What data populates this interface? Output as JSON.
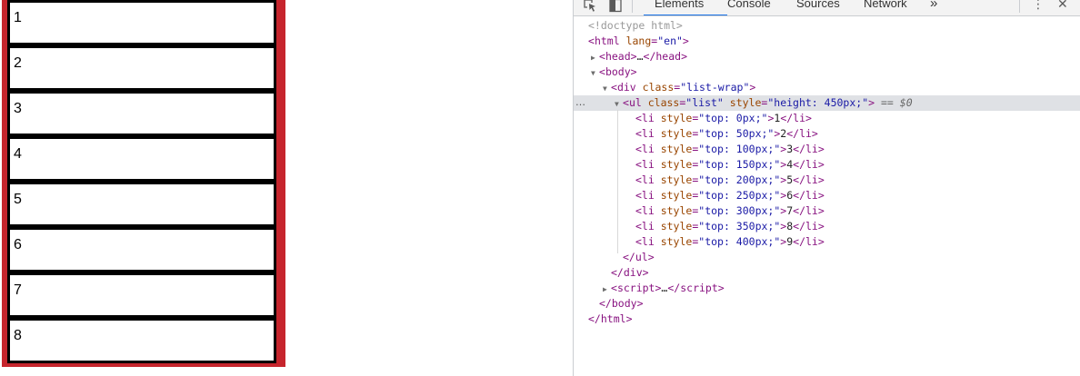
{
  "preview": {
    "list_items": [
      "1",
      "2",
      "3",
      "4",
      "5",
      "6",
      "7",
      "8"
    ]
  },
  "devtools": {
    "tabs": [
      "Elements",
      "Console",
      "Sources",
      "Network"
    ],
    "more_tabs": "»",
    "inspect_icon": "select-element-icon",
    "device_icon": "device-toolbar-icon",
    "menu_icon": "⋮",
    "close_icon": "✕",
    "accent": "#1a73e8",
    "tree": {
      "doctype": "<!doctype html>",
      "html_open": "html",
      "html_lang_attr": "lang",
      "html_lang_val": "\"en\"",
      "head": "head",
      "head_ellipsis": "…",
      "body": "body",
      "div_tag": "div",
      "div_class_attr": "class",
      "div_class_val": "\"list-wrap\"",
      "ul_tag": "ul",
      "ul_class_attr": "class",
      "ul_class_val": "\"list\"",
      "ul_style_attr": "style",
      "ul_style_val": "\"height: 450px;\"",
      "selected_marker": "== $0",
      "row_dots": "…",
      "li_rows": [
        {
          "style_val": "\"top: 0px;\"",
          "text": "1"
        },
        {
          "style_val": "\"top: 50px;\"",
          "text": "2"
        },
        {
          "style_val": "\"top: 100px;\"",
          "text": "3"
        },
        {
          "style_val": "\"top: 150px;\"",
          "text": "4"
        },
        {
          "style_val": "\"top: 200px;\"",
          "text": "5"
        },
        {
          "style_val": "\"top: 250px;\"",
          "text": "6"
        },
        {
          "style_val": "\"top: 300px;\"",
          "text": "7"
        },
        {
          "style_val": "\"top: 350px;\"",
          "text": "8"
        },
        {
          "style_val": "\"top: 400px;\"",
          "text": "9"
        }
      ],
      "script": "script",
      "script_ellipsis": "…"
    }
  }
}
